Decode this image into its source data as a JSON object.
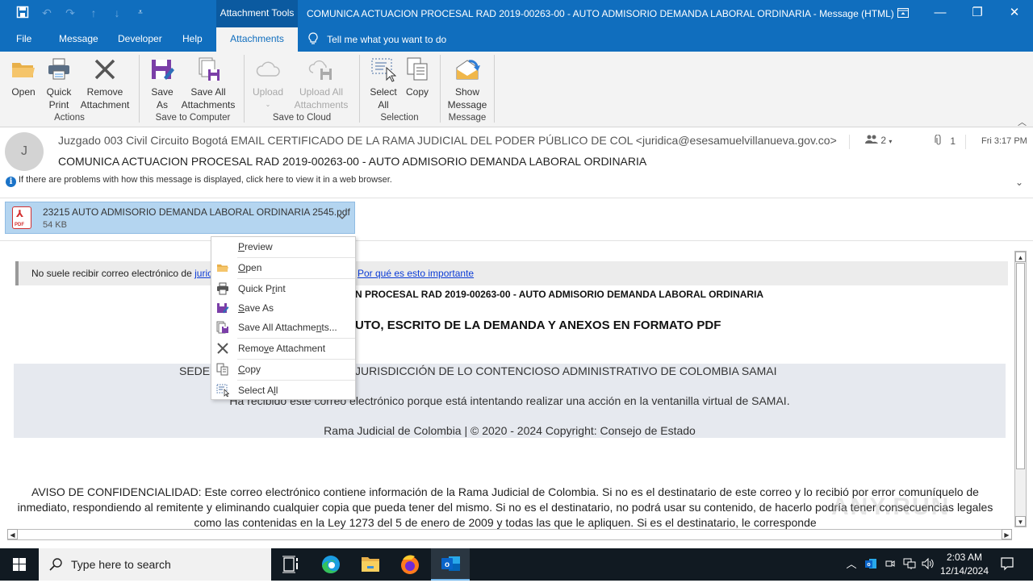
{
  "window": {
    "title": "COMUNICA ACTUACION PROCESAL RAD 2019-00263-00 - AUTO ADMISORIO DEMANDA LABORAL ORDINARIA  -  Message (HTML)",
    "context_tab_group": "Attachment Tools",
    "controls": {
      "ribbon_display": "ribbon-display-options-icon",
      "minimize": "—",
      "restore": "❐",
      "close": "✕"
    }
  },
  "quick_access": [
    {
      "name": "save-icon"
    },
    {
      "name": "undo-icon"
    },
    {
      "name": "redo-icon"
    },
    {
      "name": "previous-item-icon"
    },
    {
      "name": "next-item-icon"
    },
    {
      "name": "customize-qat-icon"
    }
  ],
  "ribbon_tabs": [
    {
      "label": "File"
    },
    {
      "label": "Message"
    },
    {
      "label": "Developer"
    },
    {
      "label": "Help"
    },
    {
      "label": "Attachments",
      "active": true
    }
  ],
  "tell_me": "Tell me what you want to do",
  "ribbon": {
    "groups": [
      {
        "label": "Actions",
        "buttons": [
          {
            "label": "Open"
          },
          {
            "label": "Quick Print"
          },
          {
            "label": "Remove Attachment"
          }
        ]
      },
      {
        "label": "Save to Computer",
        "buttons": [
          {
            "label": "Save As"
          },
          {
            "label": "Save All Attachments"
          }
        ]
      },
      {
        "label": "Save to Cloud",
        "buttons": [
          {
            "label": "Upload",
            "disabled": true
          },
          {
            "label": "Upload All Attachments",
            "disabled": true
          }
        ]
      },
      {
        "label": "Selection",
        "buttons": [
          {
            "label": "Select All"
          },
          {
            "label": "Copy"
          }
        ]
      },
      {
        "label": "Message",
        "buttons": [
          {
            "label": "Show Message"
          }
        ]
      }
    ]
  },
  "message": {
    "avatar_initial": "J",
    "sender": "Juzgado 003 Civil Circuito Bogotá EMAIL CERTIFICADO DE LA RAMA JUDICIAL DEL PODER PÚBLICO DE COL <juridica@esesamuelvillanueva.gov.co>",
    "subject": "COMUNICA ACTUACION PROCESAL RAD 2019-00263-00 - AUTO ADMISORIO DEMANDA LABORAL ORDINARIA",
    "recipients_count": "2",
    "attachments_count": "1",
    "time": "Fri 3:17 PM",
    "info_bar": "If there are problems with how this message is displayed, click here to view it in a web browser."
  },
  "attachment": {
    "name": "23215  AUTO ADMISORIO DEMANDA LABORAL ORDINARIA 2545.pdf",
    "size": "54 KB",
    "type_label": "PDF"
  },
  "context_menu": [
    {
      "label_pre": "",
      "accel": "P",
      "label_post": "review",
      "icon": ""
    },
    {
      "label_pre": "",
      "accel": "O",
      "label_post": "pen",
      "icon": "open-folder-icon"
    },
    {
      "label_pre": "Quick P",
      "accel": "r",
      "label_post": "int",
      "icon": "printer-icon"
    },
    {
      "label_pre": "",
      "accel": "S",
      "label_post": "ave As",
      "icon": "save-as-icon"
    },
    {
      "label_pre": "Save All Attachme",
      "accel": "n",
      "label_post": "ts...",
      "icon": "save-all-icon"
    },
    {
      "label_pre": "Remo",
      "accel": "v",
      "label_post": "e Attachment",
      "icon": "remove-icon"
    },
    {
      "label_pre": "",
      "accel": "C",
      "label_post": "opy",
      "icon": "copy-icon"
    },
    {
      "label_pre": "Select A",
      "accel": "l",
      "label_post": "l",
      "icon": "select-all-icon"
    }
  ],
  "body": {
    "external_warning": {
      "text": "No suele recibir correo electrónico de ",
      "link_partial": "juric",
      "why_link": "Por qué es esto importante"
    },
    "subject_line": "N PROCESAL RAD 2019-00263-00  - AUTO ADMISORIO DEMANDA LABORAL ORDINARIA",
    "heading": "UTO, ESCRITO DE LA DEMANDA Y ANEXOS EN FORMATO PDF",
    "samai": {
      "line1_left": "SEDE",
      "line1_right": "JURISDICCIÓN DE LO CONTENCIOSO ADMINISTRATIVO DE COLOMBIA SAMAI",
      "line2": "Ha recibido este correo electrónico porque está intentando realizar una acción en la ventanilla virtual de SAMAI.",
      "line3": "Rama Judicial de Colombia | © 2020 - 2024 Copyright: Consejo de Estado"
    },
    "confidentiality": "AVISO DE CONFIDENCIALIDAD: Este correo electrónico contiene información de la Rama Judicial de Colombia. Si no es el destinatario de este correo y lo recibió por error comuníquelo de inmediato, respondiendo al remitente y eliminando cualquier copia que pueda tener del mismo. Si no es el destinatario, no podrá usar su contenido, de hacerlo podría tener consecuencias legales como las contenidas en la Ley 1273 del 5 de enero de 2009 y todas las que le apliquen. Si es el destinatario, le corresponde"
  },
  "watermark": "ANY.RUN",
  "taskbar": {
    "search_placeholder": "Type here to search",
    "apps": [
      {
        "name": "task-view"
      },
      {
        "name": "edge"
      },
      {
        "name": "file-explorer"
      },
      {
        "name": "firefox"
      },
      {
        "name": "outlook",
        "active": true
      }
    ],
    "time": "2:03 AM",
    "date": "12/14/2024"
  }
}
